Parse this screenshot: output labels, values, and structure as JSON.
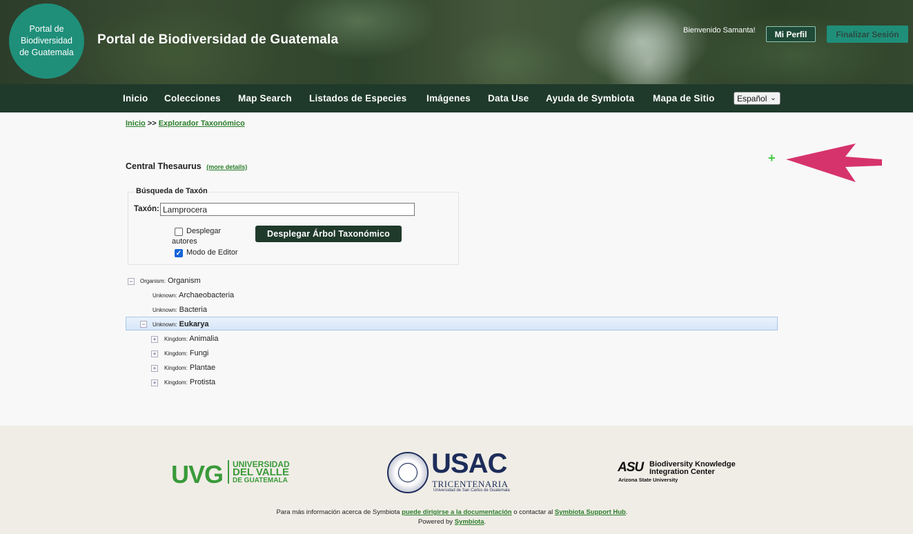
{
  "header": {
    "logo_lines": [
      "Portal de",
      "Biodiversidad",
      "de Guatemala"
    ],
    "site_title": "Portal de Biodiversidad de Guatemala",
    "welcome": "Bienvenido Samanta!",
    "profile_button": "Mi Perfil",
    "logout_button": "Finalizar Sesión"
  },
  "nav": {
    "items": [
      "Inicio",
      "Colecciones",
      "Map Search",
      "Listados de Especies",
      "Imágenes",
      "Data Use",
      "Ayuda de Symbiota",
      "Mapa de Sitio"
    ],
    "language": "Español"
  },
  "breadcrumb": {
    "home": "Inicio",
    "separator": ">>",
    "current": "Explorador Taxonómico"
  },
  "thesaurus": {
    "title": "Central Thesaurus",
    "more_details": "(more details)",
    "plus_symbol": "+"
  },
  "search": {
    "legend": "Búsqueda de Taxón",
    "taxon_label": "Taxón:",
    "taxon_value": "Lamprocera",
    "show_authors_label_1": "Desplegar",
    "show_authors_label_2": "autores",
    "show_authors_checked": false,
    "editor_mode_label": "Modo de Editor",
    "editor_mode_checked": true,
    "submit_button": "Desplegar Árbol Taxonómico"
  },
  "tree": [
    {
      "rank": "Organism:",
      "name": "Organism",
      "toggle": "−"
    },
    {
      "rank": "Unknown:",
      "name": "Archaeobacteria"
    },
    {
      "rank": "Unknown:",
      "name": "Bacteria"
    },
    {
      "rank": "Unknown:",
      "name": "Eukarya",
      "toggle": "−"
    },
    {
      "rank": "Kingdom:",
      "name": "Animalia",
      "toggle": "+"
    },
    {
      "rank": "Kingdom:",
      "name": "Fungi",
      "toggle": "+"
    },
    {
      "rank": "Kingdom:",
      "name": "Plantae",
      "toggle": "+"
    },
    {
      "rank": "Kingdom:",
      "name": "Protista",
      "toggle": "+"
    }
  ],
  "footer": {
    "uvg": {
      "abbr": "UVG",
      "line1": "UNIVERSIDAD",
      "line2": "DEL VALLE",
      "line3": "DE GUATEMALA"
    },
    "usac": {
      "abbr": "USAC",
      "line1": "TRICENTENARIA",
      "line2": "Universidad de San Carlos de Guatemala"
    },
    "asu": {
      "abbr": "ASU",
      "line1": "Biodiversity Knowledge",
      "line2": "Integration Center",
      "line3": "Arizona State University"
    },
    "text_prefix": "Para más información acerca de Symbiota",
    "doc_link": "puede dirigirse a la documentación",
    "text_mid": "o contactar al",
    "support_link": "Symbiota Support Hub",
    "text_end": ".",
    "powered_prefix": "Powered by",
    "powered_link": "Symbiota",
    "powered_end": "."
  },
  "colors": {
    "nav_bg": "#1f3a2b",
    "accent_teal": "#1f8f7a",
    "link_green": "#2a7d2a",
    "arrow": "#d6336c"
  }
}
